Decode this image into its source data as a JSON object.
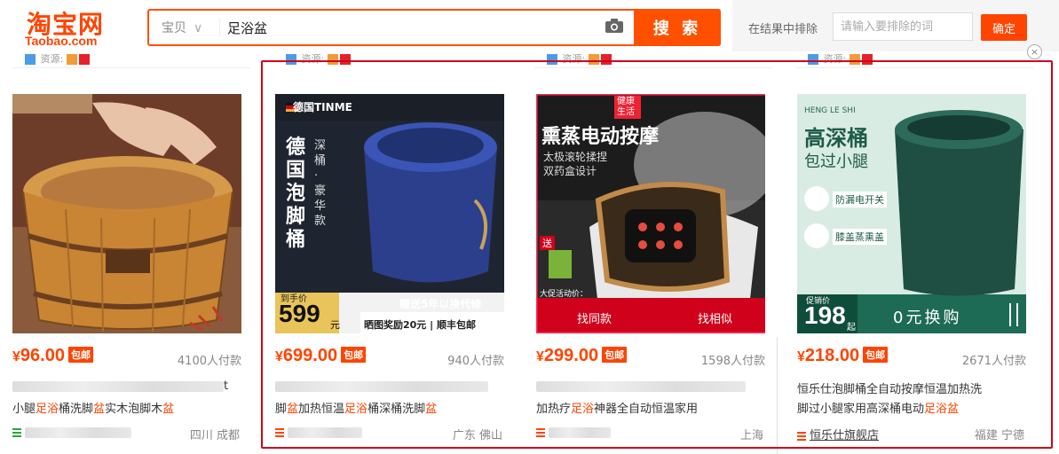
{
  "header": {
    "logo_cn": "淘宝网",
    "logo_en": "Taobao.com",
    "search_scope": "宝贝",
    "search_query": "足浴盆",
    "search_button": "搜 索",
    "exclude_label": "在结果中排除",
    "exclude_placeholder": "请输入要排除的词",
    "exclude_button": "确定"
  },
  "peek_label": "资源:",
  "close_label": "×",
  "products": [
    {
      "price": "96.00",
      "currency": "¥",
      "badge": "包邮",
      "sales": "4100人付款",
      "title_line1_tail": "t",
      "title_line2_parts": [
        "小腿",
        "足浴",
        "桶洗脚",
        "盆",
        "实木泡脚木",
        "盆"
      ],
      "location": "四川 成都",
      "image_labels": []
    },
    {
      "price": "699.00",
      "currency": "¥",
      "badge": "包邮",
      "sales": "940人付款",
      "title_line2_parts": [
        "脚",
        "盆",
        "加热恒温",
        "足浴",
        "桶深桶洗脚",
        "盆"
      ],
      "location": "广东 佛山",
      "image_labels": [
        "德国TINME",
        "德国泡脚桶",
        "深桶·豪华款",
        "到手价",
        "599",
        "元",
        "赠送5年以换代修",
        "晒图奖励20元 | 顺丰包邮"
      ]
    },
    {
      "price": "299.00",
      "currency": "¥",
      "badge": "包邮",
      "sales": "1598人付款",
      "title_line2_parts": [
        "加热疗",
        "足浴",
        "神器全自动恒温家用"
      ],
      "location": "上海",
      "overlay_find_same": "找同款",
      "overlay_find_similar": "找相似",
      "image_labels": [
        "健康生活",
        "熏蒸电动按摩",
        "太极滚轮揉捏",
        "双药盒设计",
        "送",
        "大促活动价："
      ]
    },
    {
      "price": "218.00",
      "currency": "¥",
      "badge": "包邮",
      "sales": "2671人付款",
      "title_line1": "恒乐仕泡脚桶全自动按摩恒温加热洗",
      "title_line2_parts": [
        "脚过小腿家用高深桶电动",
        "足浴盆"
      ],
      "shop": "恒乐仕旗舰店",
      "location": "福建 宁德",
      "image_labels": [
        "HENG LE SHI",
        "高深桶",
        "包过小腿",
        "防漏电开关",
        "膝盖蒸熏盖",
        "促销价",
        "198",
        "起",
        "0元换购"
      ]
    }
  ],
  "colors": {
    "brand": "#ff4400",
    "search_border": "#ff5000",
    "highlight": "#d0021b"
  }
}
